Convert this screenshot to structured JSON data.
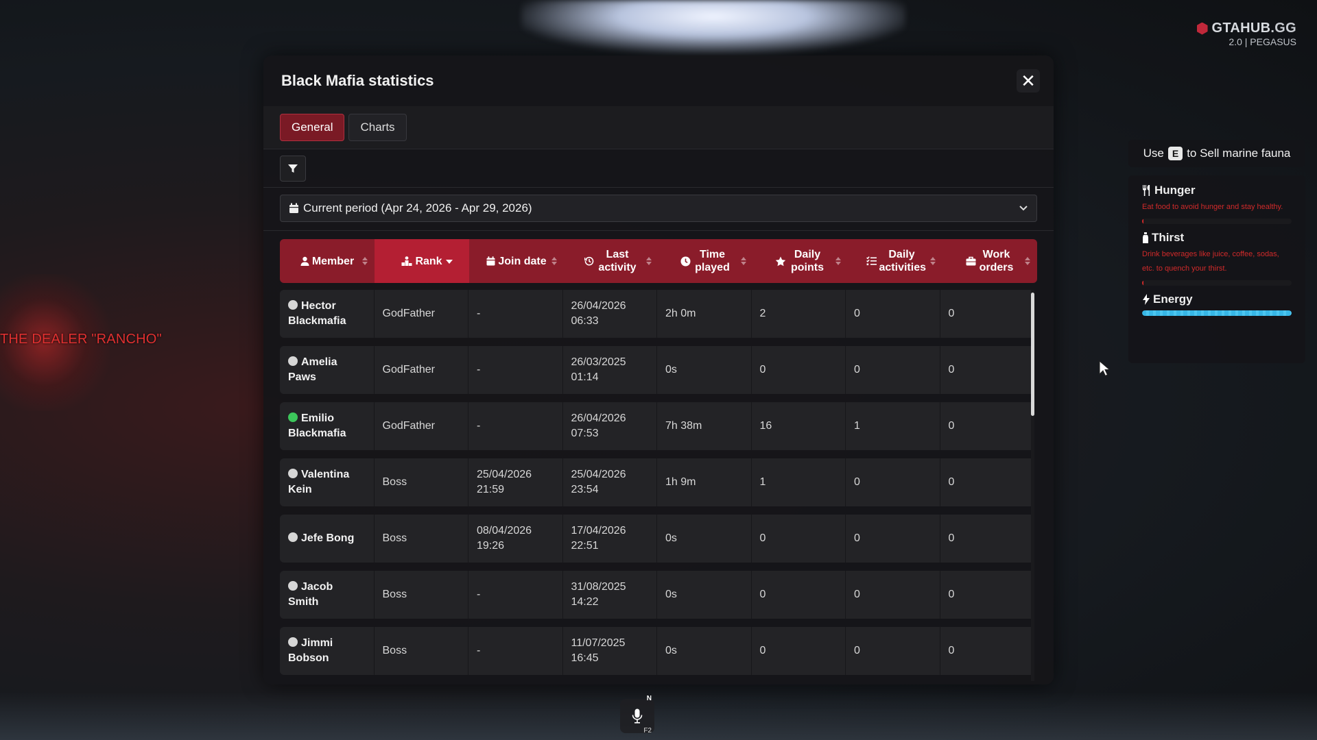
{
  "world": {
    "dealer_label": "THE DEALER \"RANCHO\""
  },
  "brand": {
    "name_main": "GTAHUB",
    "name_tld": ".GG",
    "subtitle": "2.0 | PEGASUS",
    "logo_icon": "hexagon-logo-icon",
    "color": "#c0283a"
  },
  "modal": {
    "title": "Black Mafia statistics",
    "close_label": "✕",
    "tabs": [
      {
        "label": "General",
        "active": true
      },
      {
        "label": "Charts",
        "active": false
      }
    ],
    "filter_icon": "filter-icon",
    "period": {
      "label": "Current period (Apr 24, 2026 - Apr 29, 2026)",
      "icon": "calendar-icon"
    }
  },
  "table": {
    "header_color": "#8a1c2a",
    "sorted_color": "#b41f33",
    "columns": [
      {
        "label": "Member",
        "icon": "user-icon",
        "sorted": false
      },
      {
        "label": "Rank",
        "icon": "ranking-icon",
        "sorted": true
      },
      {
        "label": "Join date",
        "icon": "calendar-icon",
        "sorted": false
      },
      {
        "label": "Last activity",
        "icon": "history-icon",
        "sorted": false
      },
      {
        "label": "Time played",
        "icon": "clock-icon",
        "sorted": false
      },
      {
        "label": "Daily points",
        "icon": "star-icon",
        "sorted": false
      },
      {
        "label": "Daily activities",
        "icon": "list-check-icon",
        "sorted": false
      },
      {
        "label": "Work orders",
        "icon": "briefcase-icon",
        "sorted": false
      }
    ],
    "rows": [
      {
        "member": "Hector Blackmafia",
        "online": false,
        "rank": "GodFather",
        "join_date": "-",
        "last_activity": "26/04/2026 06:33",
        "time_played": "2h 0m",
        "daily_points": "2",
        "daily_activities": "0",
        "work_orders": "0"
      },
      {
        "member": "Amelia Paws",
        "online": false,
        "rank": "GodFather",
        "join_date": "-",
        "last_activity": "26/03/2025 01:14",
        "time_played": "0s",
        "daily_points": "0",
        "daily_activities": "0",
        "work_orders": "0"
      },
      {
        "member": "Emilio Blackmafia",
        "online": true,
        "rank": "GodFather",
        "join_date": "-",
        "last_activity": "26/04/2026 07:53",
        "time_played": "7h 38m",
        "daily_points": "16",
        "daily_activities": "1",
        "work_orders": "0"
      },
      {
        "member": "Valentina Kein",
        "online": false,
        "rank": "Boss",
        "join_date": "25/04/2026 21:59",
        "last_activity": "25/04/2026 23:54",
        "time_played": "1h 9m",
        "daily_points": "1",
        "daily_activities": "0",
        "work_orders": "0"
      },
      {
        "member": "Jefe Bong",
        "online": false,
        "rank": "Boss",
        "join_date": "08/04/2026 19:26",
        "last_activity": "17/04/2026 22:51",
        "time_played": "0s",
        "daily_points": "0",
        "daily_activities": "0",
        "work_orders": "0"
      },
      {
        "member": "Jacob Smith",
        "online": false,
        "rank": "Boss",
        "join_date": "-",
        "last_activity": "31/08/2025 14:22",
        "time_played": "0s",
        "daily_points": "0",
        "daily_activities": "0",
        "work_orders": "0"
      },
      {
        "member": "Jimmi Bobson",
        "online": false,
        "rank": "Boss",
        "join_date": "-",
        "last_activity": "11/07/2025 16:45",
        "time_played": "0s",
        "daily_points": "0",
        "daily_activities": "0",
        "work_orders": "0"
      }
    ]
  },
  "hud": {
    "prompt": {
      "prefix": "Use",
      "key": "E",
      "suffix": "to Sell marine fauna"
    },
    "hunger": {
      "title": "Hunger",
      "desc": "Eat food to avoid hunger and stay healthy.",
      "level": 0.01,
      "icon": "utensils-icon"
    },
    "thirst": {
      "title": "Thirst",
      "desc": "Drink beverages like juice, coffee, sodas, etc. to quench your thirst.",
      "level": 0.01,
      "icon": "bottle-icon"
    },
    "energy": {
      "title": "Energy",
      "level": 1.0,
      "icon": "bolt-icon"
    },
    "status_color": "#d12a2a",
    "energy_color": "#37b7e6"
  },
  "voice": {
    "mic_icon": "microphone-icon",
    "badge": "N",
    "key": "F2"
  }
}
